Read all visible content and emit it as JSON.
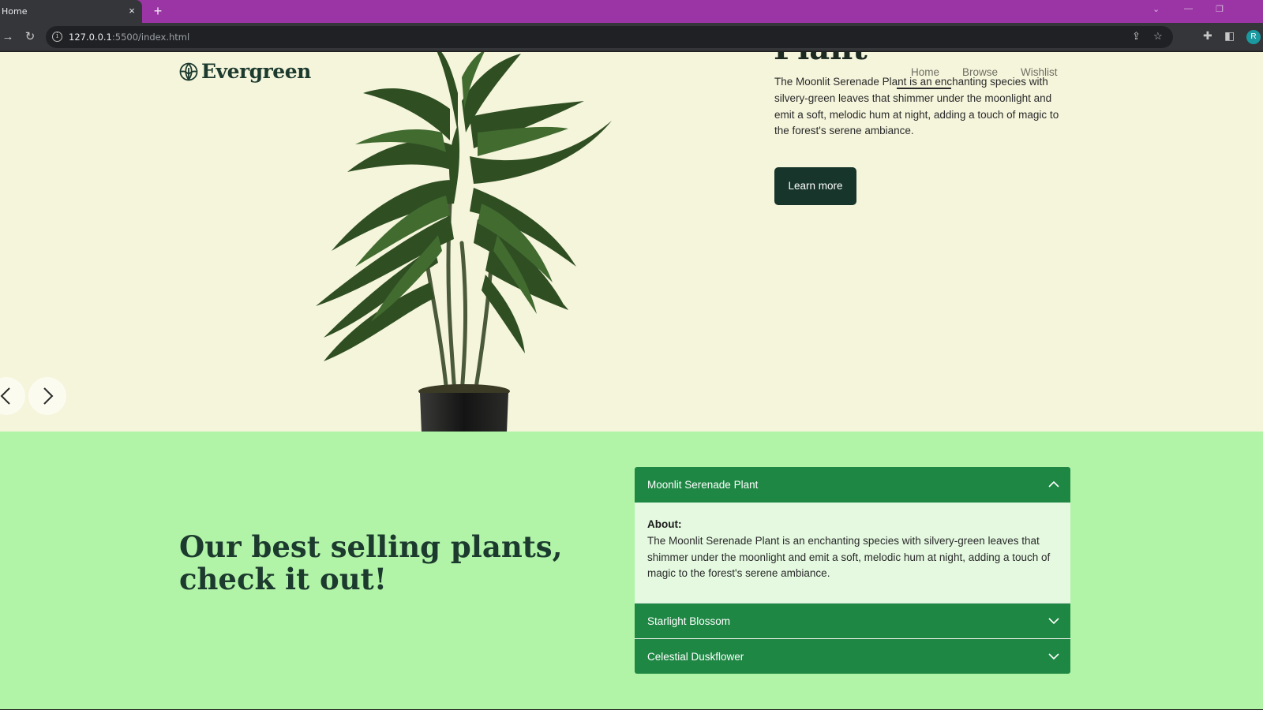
{
  "browser": {
    "tab_title": "Home",
    "tab_close": "×",
    "new_tab": "+",
    "url_host": "127.0.0.1",
    "url_path": ":5500/index.html",
    "profile_initial": "R",
    "colors": {
      "tabstrip": "#9b35a6",
      "toolbar": "#35363a"
    }
  },
  "site": {
    "logo_text": "Evergreen",
    "nav": [
      "Home",
      "Browse",
      "Wishlist"
    ],
    "hero": {
      "title_fragment": "Plant",
      "description": "The Moonlit Serenade Plant is an enchanting species with silvery-green leaves that shimmer under the moonlight and emit a soft, melodic hum at night, adding a touch of magic to the forest's serene ambiance.",
      "cta_label": "Learn more",
      "prev_icon": "chevron-left-icon",
      "next_icon": "chevron-right-icon"
    },
    "best_sellers": {
      "title": "Our best selling plants, check it out!",
      "accordion": [
        {
          "name": "Moonlit Serenade Plant",
          "expanded": true,
          "about_label": "About:",
          "about_text": "The Moonlit Serenade Plant is an enchanting species with silvery-green leaves that shimmer under the moonlight and emit a soft, melodic hum at night, adding a touch of magic to the forest's serene ambiance."
        },
        {
          "name": "Starlight Blossom",
          "expanded": false
        },
        {
          "name": "Celestial Duskflower",
          "expanded": false
        }
      ]
    },
    "colors": {
      "hero_bg": "#f5f5dc",
      "section_bg": "#b1f4a8",
      "accordion_head": "#1e8743",
      "accordion_body": "#e4f9e0",
      "dark_green": "#17352a"
    }
  }
}
